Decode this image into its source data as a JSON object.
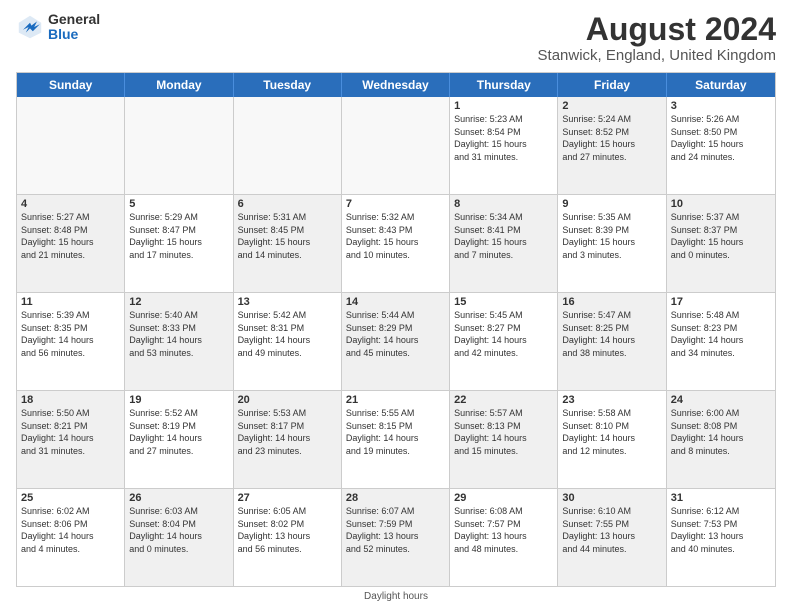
{
  "logo": {
    "general": "General",
    "blue": "Blue"
  },
  "title": "August 2024",
  "subtitle": "Stanwick, England, United Kingdom",
  "weekdays": [
    "Sunday",
    "Monday",
    "Tuesday",
    "Wednesday",
    "Thursday",
    "Friday",
    "Saturday"
  ],
  "footer": "Daylight hours",
  "weeks": [
    [
      {
        "day": "",
        "text": "",
        "empty": true
      },
      {
        "day": "",
        "text": "",
        "empty": true
      },
      {
        "day": "",
        "text": "",
        "empty": true
      },
      {
        "day": "",
        "text": "",
        "empty": true
      },
      {
        "day": "1",
        "text": "Sunrise: 5:23 AM\nSunset: 8:54 PM\nDaylight: 15 hours\nand 31 minutes."
      },
      {
        "day": "2",
        "text": "Sunrise: 5:24 AM\nSunset: 8:52 PM\nDaylight: 15 hours\nand 27 minutes.",
        "shaded": true
      },
      {
        "day": "3",
        "text": "Sunrise: 5:26 AM\nSunset: 8:50 PM\nDaylight: 15 hours\nand 24 minutes."
      }
    ],
    [
      {
        "day": "4",
        "text": "Sunrise: 5:27 AM\nSunset: 8:48 PM\nDaylight: 15 hours\nand 21 minutes.",
        "shaded": true
      },
      {
        "day": "5",
        "text": "Sunrise: 5:29 AM\nSunset: 8:47 PM\nDaylight: 15 hours\nand 17 minutes."
      },
      {
        "day": "6",
        "text": "Sunrise: 5:31 AM\nSunset: 8:45 PM\nDaylight: 15 hours\nand 14 minutes.",
        "shaded": true
      },
      {
        "day": "7",
        "text": "Sunrise: 5:32 AM\nSunset: 8:43 PM\nDaylight: 15 hours\nand 10 minutes."
      },
      {
        "day": "8",
        "text": "Sunrise: 5:34 AM\nSunset: 8:41 PM\nDaylight: 15 hours\nand 7 minutes.",
        "shaded": true
      },
      {
        "day": "9",
        "text": "Sunrise: 5:35 AM\nSunset: 8:39 PM\nDaylight: 15 hours\nand 3 minutes."
      },
      {
        "day": "10",
        "text": "Sunrise: 5:37 AM\nSunset: 8:37 PM\nDaylight: 15 hours\nand 0 minutes.",
        "shaded": true
      }
    ],
    [
      {
        "day": "11",
        "text": "Sunrise: 5:39 AM\nSunset: 8:35 PM\nDaylight: 14 hours\nand 56 minutes."
      },
      {
        "day": "12",
        "text": "Sunrise: 5:40 AM\nSunset: 8:33 PM\nDaylight: 14 hours\nand 53 minutes.",
        "shaded": true
      },
      {
        "day": "13",
        "text": "Sunrise: 5:42 AM\nSunset: 8:31 PM\nDaylight: 14 hours\nand 49 minutes."
      },
      {
        "day": "14",
        "text": "Sunrise: 5:44 AM\nSunset: 8:29 PM\nDaylight: 14 hours\nand 45 minutes.",
        "shaded": true
      },
      {
        "day": "15",
        "text": "Sunrise: 5:45 AM\nSunset: 8:27 PM\nDaylight: 14 hours\nand 42 minutes."
      },
      {
        "day": "16",
        "text": "Sunrise: 5:47 AM\nSunset: 8:25 PM\nDaylight: 14 hours\nand 38 minutes.",
        "shaded": true
      },
      {
        "day": "17",
        "text": "Sunrise: 5:48 AM\nSunset: 8:23 PM\nDaylight: 14 hours\nand 34 minutes."
      }
    ],
    [
      {
        "day": "18",
        "text": "Sunrise: 5:50 AM\nSunset: 8:21 PM\nDaylight: 14 hours\nand 31 minutes.",
        "shaded": true
      },
      {
        "day": "19",
        "text": "Sunrise: 5:52 AM\nSunset: 8:19 PM\nDaylight: 14 hours\nand 27 minutes."
      },
      {
        "day": "20",
        "text": "Sunrise: 5:53 AM\nSunset: 8:17 PM\nDaylight: 14 hours\nand 23 minutes.",
        "shaded": true
      },
      {
        "day": "21",
        "text": "Sunrise: 5:55 AM\nSunset: 8:15 PM\nDaylight: 14 hours\nand 19 minutes."
      },
      {
        "day": "22",
        "text": "Sunrise: 5:57 AM\nSunset: 8:13 PM\nDaylight: 14 hours\nand 15 minutes.",
        "shaded": true
      },
      {
        "day": "23",
        "text": "Sunrise: 5:58 AM\nSunset: 8:10 PM\nDaylight: 14 hours\nand 12 minutes."
      },
      {
        "day": "24",
        "text": "Sunrise: 6:00 AM\nSunset: 8:08 PM\nDaylight: 14 hours\nand 8 minutes.",
        "shaded": true
      }
    ],
    [
      {
        "day": "25",
        "text": "Sunrise: 6:02 AM\nSunset: 8:06 PM\nDaylight: 14 hours\nand 4 minutes."
      },
      {
        "day": "26",
        "text": "Sunrise: 6:03 AM\nSunset: 8:04 PM\nDaylight: 14 hours\nand 0 minutes.",
        "shaded": true
      },
      {
        "day": "27",
        "text": "Sunrise: 6:05 AM\nSunset: 8:02 PM\nDaylight: 13 hours\nand 56 minutes."
      },
      {
        "day": "28",
        "text": "Sunrise: 6:07 AM\nSunset: 7:59 PM\nDaylight: 13 hours\nand 52 minutes.",
        "shaded": true
      },
      {
        "day": "29",
        "text": "Sunrise: 6:08 AM\nSunset: 7:57 PM\nDaylight: 13 hours\nand 48 minutes."
      },
      {
        "day": "30",
        "text": "Sunrise: 6:10 AM\nSunset: 7:55 PM\nDaylight: 13 hours\nand 44 minutes.",
        "shaded": true
      },
      {
        "day": "31",
        "text": "Sunrise: 6:12 AM\nSunset: 7:53 PM\nDaylight: 13 hours\nand 40 minutes."
      }
    ]
  ]
}
